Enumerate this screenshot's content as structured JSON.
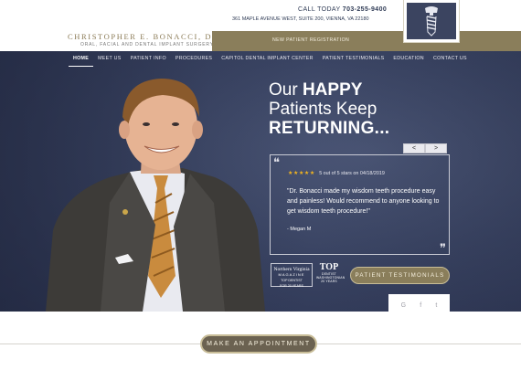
{
  "header": {
    "doctor_name": "CHRISTOPHER E. BONACCI, DDS, MD",
    "practice_tagline": "ORAL, FACIAL AND DENTAL IMPLANT SURGERY",
    "call_label": "CALL TODAY",
    "phone": "703-255-9400",
    "address": "361 MAPLE AVENUE WEST, SUITE 200, VIENNA, VA 22180",
    "registration_link": "NEW PATIENT REGISTRATION"
  },
  "nav": {
    "items": [
      {
        "label": "HOME",
        "active": true
      },
      {
        "label": "MEET US"
      },
      {
        "label": "PATIENT INFO"
      },
      {
        "label": "PROCEDURES"
      },
      {
        "label": "CAPITOL DENTAL IMPLANT CENTER"
      },
      {
        "label": "PATIENT TESTIMONIALS"
      },
      {
        "label": "EDUCATION"
      },
      {
        "label": "CONTACT US"
      }
    ]
  },
  "hero": {
    "headline_line1_prefix": "Our ",
    "headline_line1_bold": "HAPPY",
    "headline_line2": "Patients Keep",
    "headline_line3": "RETURNING...",
    "prev_arrow": "<",
    "next_arrow": ">"
  },
  "review": {
    "stars": "★★★★★",
    "rating_text": "5 out of 5 stars on 04/18/2019",
    "text": "\"Dr. Bonacci made my wisdom teeth procedure easy and painless! Would recommend to anyone looking to get wisdom teeth procedure!\"",
    "reviewer": "- Megan M"
  },
  "badges": {
    "nv_line1": "Northern Virginia",
    "nv_line2": "MAGAZINE",
    "nv_line3": "TOP DENTIST",
    "nv_line4": "FOR 20 YEARS",
    "top_big": "TOP",
    "top_line1": "DENTIST",
    "top_line2": "WASHINGTONIAN",
    "top_line3": "20 YEARS"
  },
  "testimonials_button": "PATIENT TESTIMONIALS",
  "social": {
    "google": "G",
    "facebook": "f",
    "twitter": "t"
  },
  "appointment_button": "MAKE AN APPOINTMENT",
  "colors": {
    "gold": "#8a7e5b",
    "navy": "#3a4463",
    "star": "#f3b51e"
  }
}
